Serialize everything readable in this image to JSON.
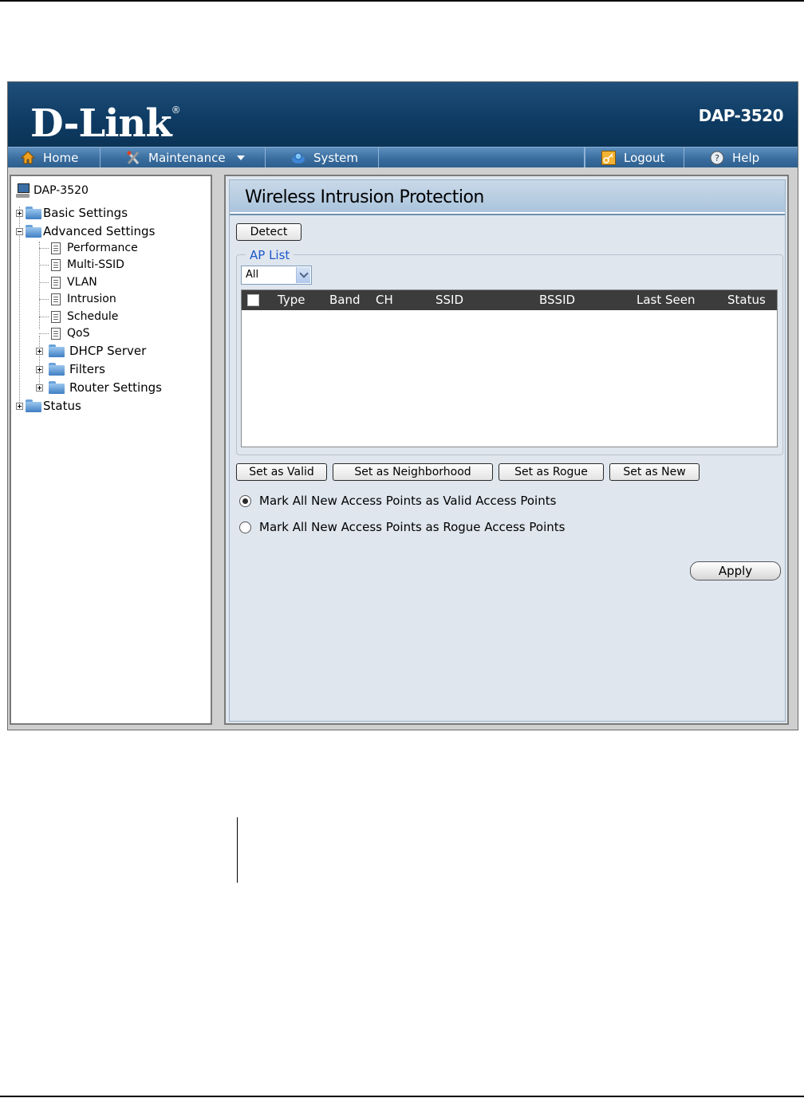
{
  "header": {
    "brand": "D-Link",
    "model": "DAP-3520"
  },
  "nav": {
    "home": "Home",
    "maintenance": "Maintenance",
    "system": "System",
    "logout": "Logout",
    "help": "Help"
  },
  "tree": {
    "root": "DAP-3520",
    "basic": "Basic Settings",
    "advanced": "Advanced Settings",
    "advanced_items": [
      "Performance",
      "Multi-SSID",
      "VLAN",
      "Intrusion",
      "Schedule",
      "QoS"
    ],
    "dhcp": "DHCP Server",
    "filters": "Filters",
    "router": "Router Settings",
    "status": "Status"
  },
  "page": {
    "title": "Wireless Intrusion Protection",
    "detect_label": "Detect",
    "ap_list_legend": "AP List",
    "filter_value": "All",
    "columns": [
      "Type",
      "Band",
      "CH",
      "SSID",
      "BSSID",
      "Last Seen",
      "Status"
    ],
    "rows": [],
    "actions": [
      "Set as Valid",
      "Set as Neighborhood",
      "Set as Rogue",
      "Set as New"
    ],
    "radio_valid": "Mark All New Access Points as Valid Access Points",
    "radio_rogue": "Mark All New Access Points as Rogue Access Points",
    "radio_selected": "valid",
    "apply_label": "Apply"
  }
}
